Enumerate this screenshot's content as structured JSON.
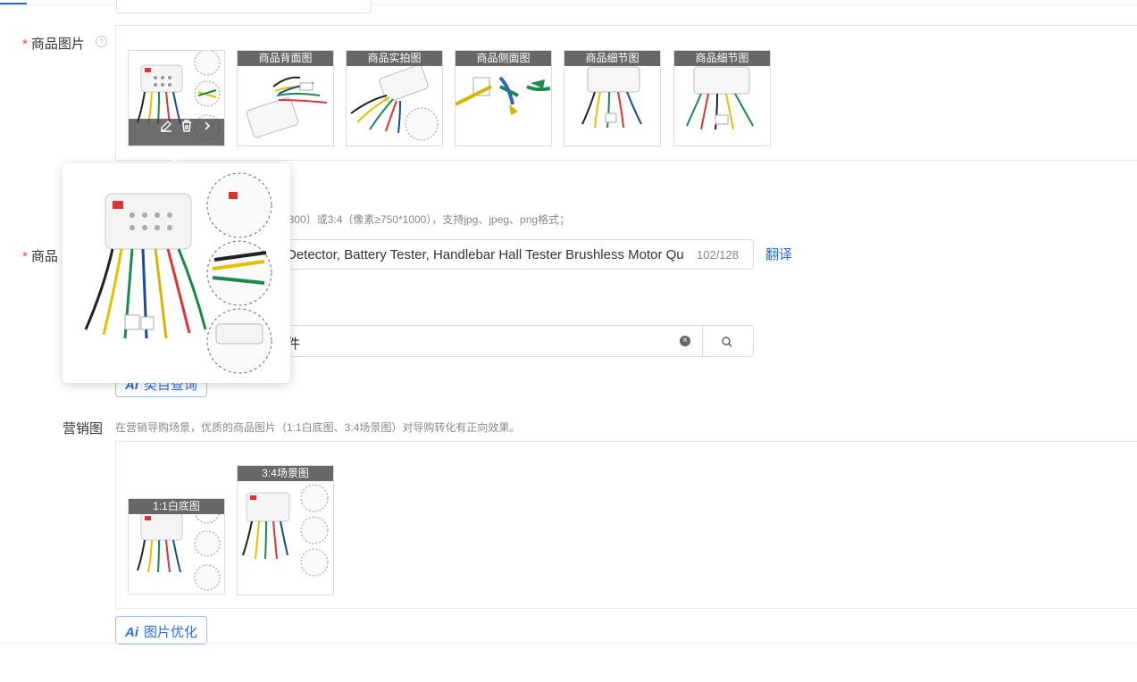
{
  "product_images": {
    "label": "商品图片",
    "required_mark": "*",
    "help_icon": "question-circle-icon",
    "thumbnails": [
      {
        "tag": ""
      },
      {
        "tag": "商品背面图"
      },
      {
        "tag": "商品实拍图"
      },
      {
        "tag": "商品侧面图"
      },
      {
        "tag": "商品细节图"
      },
      {
        "tag": "商品细节图"
      }
    ],
    "hint_tail": "*800）或3:4（像素≥750*1000），支持jpg、jpeg、png格式；"
  },
  "product_title": {
    "label": "商品",
    "required_mark": "*",
    "value": "Detector, Battery Tester, Handlebar Hall Tester Brushless Motor Qu",
    "count": "102/128",
    "translate_label": "翻译"
  },
  "category": {
    "value": "件",
    "clear_icon": "clear-circle-icon",
    "search_icon": "search-icon",
    "ai_button_label": "类目查询",
    "ai_mark": "Ai"
  },
  "marketing_images": {
    "label": "营销图",
    "hint": "在营销导购场景，优质的商品图片（1:1白底图、3:4场景图）对导购转化有正向效果。",
    "thumbnails": [
      {
        "tag": "1:1白底图"
      },
      {
        "tag": "3:4场景图"
      }
    ],
    "ai_button_label": "图片优化",
    "ai_mark": "Ai"
  },
  "colors": {
    "accent": "#1f6fe0",
    "required": "#f5483b"
  }
}
